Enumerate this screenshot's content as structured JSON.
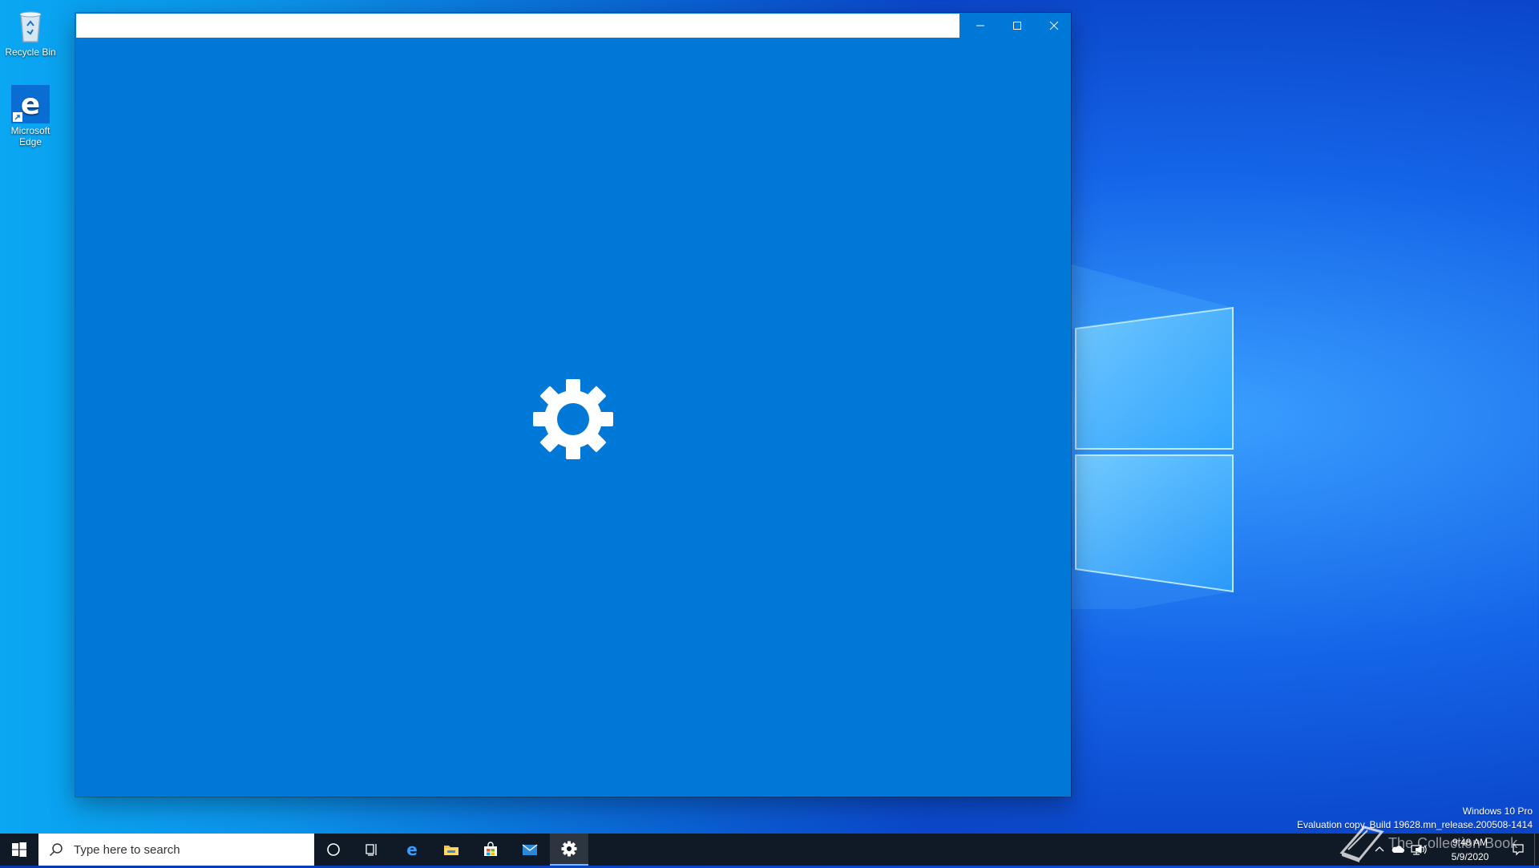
{
  "desktop": {
    "icons": [
      {
        "label": "Recycle Bin"
      },
      {
        "label": "Microsoft Edge"
      }
    ]
  },
  "window": {
    "title_text": "",
    "caption": {
      "minimize": "minimize",
      "maximize": "maximize",
      "close": "close"
    }
  },
  "taskbar": {
    "search_placeholder": "Type here to search",
    "pinned": [
      "cortana",
      "task-view",
      "edge",
      "file-explorer",
      "store",
      "mail",
      "settings"
    ],
    "active_app": "settings"
  },
  "tray": {
    "time": "9:48 AM",
    "date": "5/9/2020"
  },
  "watermark": {
    "line1": "Windows 10 Pro",
    "line2": "Evaluation copy. Build 19628.mn_release.200508-1414"
  },
  "overlay": {
    "text": "The Collection Book"
  },
  "colors": {
    "window_bg": "#0078d7",
    "taskbar_bg": "#101a26"
  }
}
